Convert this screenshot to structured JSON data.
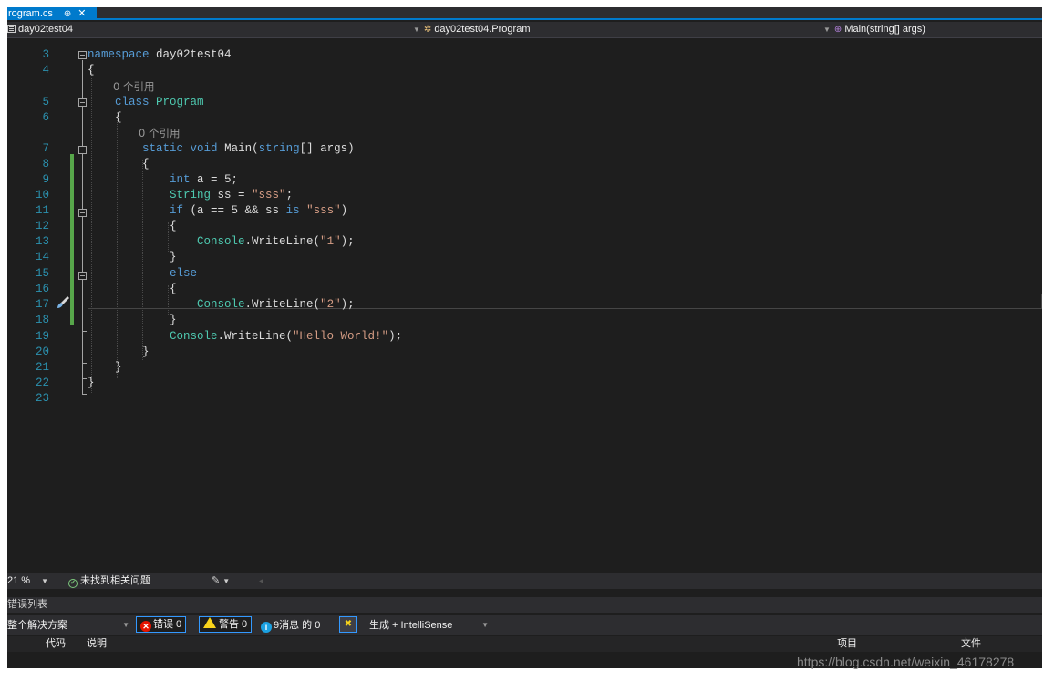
{
  "tab": {
    "title": "rogram.cs",
    "pin": "⊕",
    "close": "✕"
  },
  "navbar": {
    "project": "day02test04",
    "type": "day02test04.Program",
    "member": "Main(string[] args)"
  },
  "editor": {
    "references_label_1": "0 个引用",
    "references_label_2": "0 个引用",
    "line_numbers": [
      "3",
      "4",
      "5",
      "6",
      "7",
      "8",
      "9",
      "10",
      "11",
      "12",
      "13",
      "14",
      "15",
      "16",
      "17",
      "18",
      "19",
      "20",
      "21",
      "22",
      "23"
    ]
  },
  "statusbar": {
    "zoom": "21 %",
    "issues": "未找到相关问题"
  },
  "error_list": {
    "title": "错误列表",
    "scope": "整个解决方案",
    "errors": "错误 0",
    "warnings": "警告 0",
    "messages": "9消息 的 0",
    "build_source": "生成 + IntelliSense",
    "columns": {
      "code": "代码",
      "description": "说明",
      "project": "项目",
      "file": "文件"
    }
  },
  "watermark": "https://blog.csdn.net/weixin_46178278",
  "colors": {
    "accent": "#007acc",
    "keyword": "#569cd6",
    "type": "#4ec9b0",
    "string": "#d69d85",
    "line_number": "#2b91af",
    "change_bar": "#57a64a"
  }
}
